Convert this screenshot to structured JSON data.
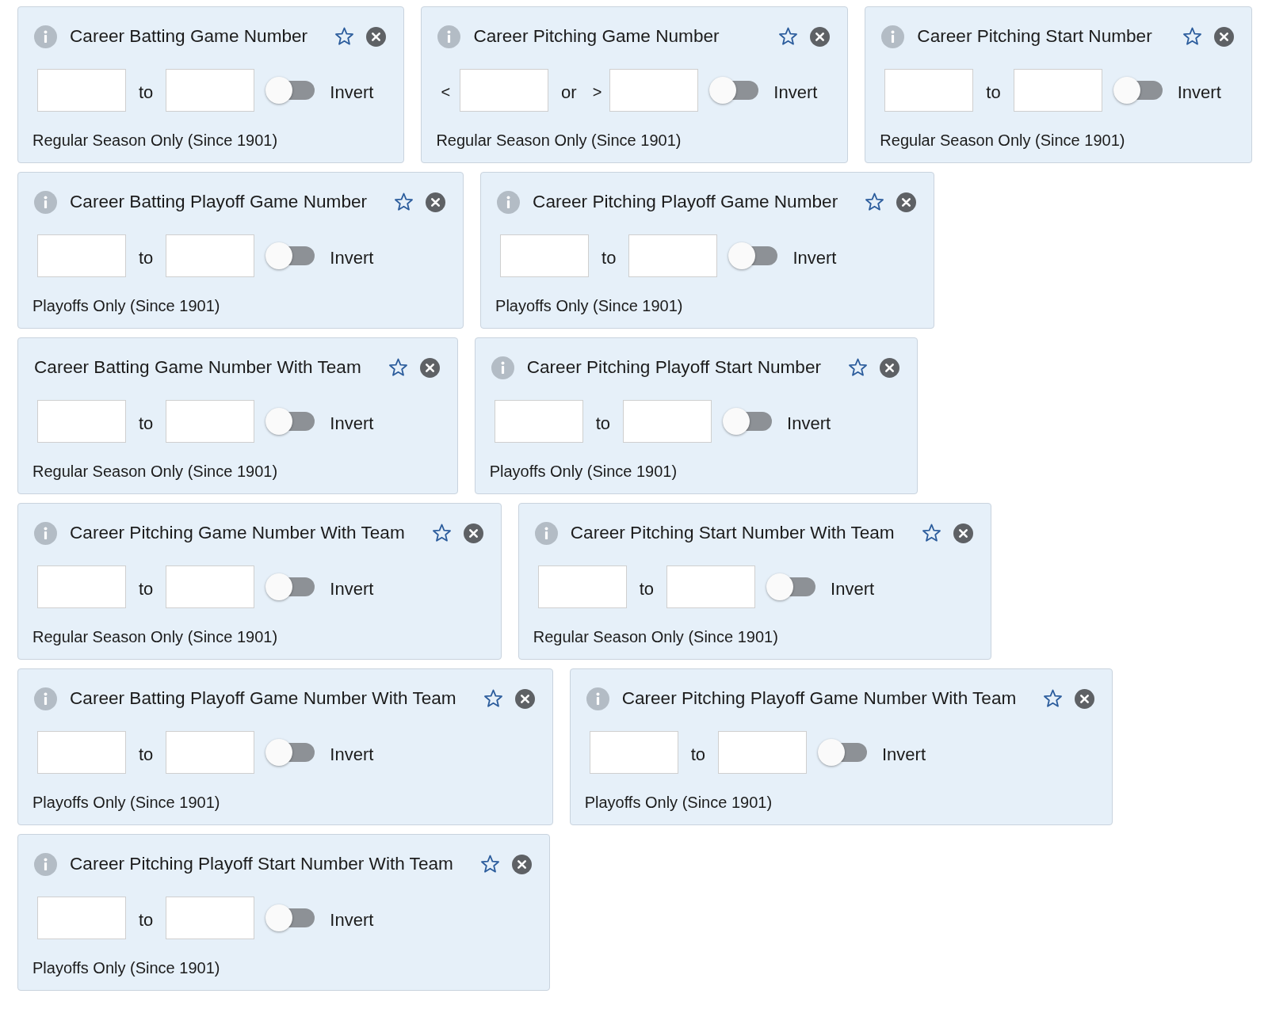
{
  "filters": [
    {
      "title": "Career Batting Game Number",
      "info": true,
      "starred": false,
      "range": {
        "joiner": "to"
      },
      "invert": {
        "label": "Invert",
        "on": false
      },
      "note": "Regular Season Only (Since 1901)"
    },
    {
      "title": "Career Pitching Game Number",
      "info": true,
      "starred": false,
      "range": {
        "lower_prefix": "<",
        "joiner": "or",
        "upper_prefix": ">"
      },
      "invert": {
        "label": "Invert",
        "on": false
      },
      "note": "Regular Season Only (Since 1901)"
    },
    {
      "title": "Career Pitching Start Number",
      "info": true,
      "starred": false,
      "range": {
        "joiner": "to"
      },
      "invert": {
        "label": "Invert",
        "on": false
      },
      "note": "Regular Season Only (Since 1901)"
    },
    {
      "title": "Career Batting Playoff Game Number",
      "info": true,
      "starred": false,
      "range": {
        "joiner": "to"
      },
      "invert": {
        "label": "Invert",
        "on": false
      },
      "note": "Playoffs Only (Since 1901)"
    },
    {
      "title": "Career Pitching Playoff Game Number",
      "info": true,
      "starred": false,
      "range": {
        "joiner": "to"
      },
      "invert": {
        "label": "Invert",
        "on": false
      },
      "note": "Playoffs Only (Since 1901)"
    },
    {
      "title": "Career Batting Game Number With Team",
      "info": false,
      "starred": false,
      "range": {
        "joiner": "to"
      },
      "invert": {
        "label": "Invert",
        "on": false
      },
      "note": "Regular Season Only (Since 1901)"
    },
    {
      "title": "Career Pitching Playoff Start Number",
      "info": true,
      "starred": false,
      "range": {
        "joiner": "to"
      },
      "invert": {
        "label": "Invert",
        "on": false
      },
      "note": "Playoffs Only (Since 1901)"
    },
    {
      "title": "Career Pitching Game Number With Team",
      "info": true,
      "starred": false,
      "range": {
        "joiner": "to"
      },
      "invert": {
        "label": "Invert",
        "on": false
      },
      "note": "Regular Season Only (Since 1901)"
    },
    {
      "title": "Career Pitching Start Number With Team",
      "info": true,
      "starred": false,
      "range": {
        "joiner": "to"
      },
      "invert": {
        "label": "Invert",
        "on": false
      },
      "note": "Regular Season Only (Since 1901)"
    },
    {
      "title": "Career Batting Playoff Game Number With Team",
      "info": true,
      "starred": false,
      "range": {
        "joiner": "to"
      },
      "invert": {
        "label": "Invert",
        "on": false
      },
      "note": "Playoffs Only (Since 1901)"
    },
    {
      "title": "Career Pitching Playoff Game Number With Team",
      "info": true,
      "starred": false,
      "range": {
        "joiner": "to"
      },
      "invert": {
        "label": "Invert",
        "on": false
      },
      "note": "Playoffs Only (Since 1901)"
    },
    {
      "title": "Career Pitching Playoff Start Number With Team",
      "info": true,
      "starred": false,
      "range": {
        "joiner": "to"
      },
      "invert": {
        "label": "Invert",
        "on": false
      },
      "note": "Playoffs Only (Since 1901)"
    }
  ]
}
